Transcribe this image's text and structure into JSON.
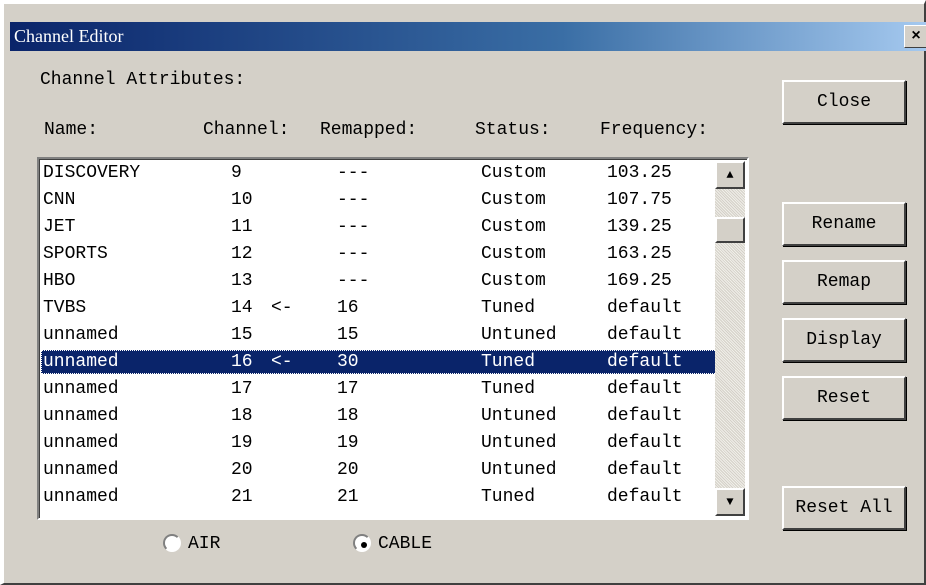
{
  "window": {
    "title": "Channel Editor",
    "close_glyph": "×"
  },
  "labels": {
    "channel_attributes": "Channel Attributes:",
    "col_name": "Name:",
    "col_channel": "Channel:",
    "col_remapped": "Remapped:",
    "col_status": "Status:",
    "col_frequency": "Frequency:"
  },
  "buttons": {
    "close": "Close",
    "rename": "Rename",
    "remap": "Remap",
    "display": "Display",
    "reset": "Reset",
    "reset_all": "Reset All"
  },
  "channels": [
    {
      "name": "DISCOVERY",
      "channel": "9",
      "arrow": "",
      "remapped": "---",
      "status": "Custom",
      "frequency": "103.25"
    },
    {
      "name": "CNN",
      "channel": "10",
      "arrow": "",
      "remapped": "---",
      "status": "Custom",
      "frequency": "107.75"
    },
    {
      "name": "JET",
      "channel": "11",
      "arrow": "",
      "remapped": "---",
      "status": "Custom",
      "frequency": "139.25"
    },
    {
      "name": "SPORTS",
      "channel": "12",
      "arrow": "",
      "remapped": "---",
      "status": "Custom",
      "frequency": "163.25"
    },
    {
      "name": "HBO",
      "channel": "13",
      "arrow": "",
      "remapped": "---",
      "status": "Custom",
      "frequency": "169.25"
    },
    {
      "name": "TVBS",
      "channel": "14",
      "arrow": "<-",
      "remapped": "16",
      "status": "Tuned",
      "frequency": "default"
    },
    {
      "name": "unnamed",
      "channel": "15",
      "arrow": "",
      "remapped": "15",
      "status": "Untuned",
      "frequency": "default"
    },
    {
      "name": "unnamed",
      "channel": "16",
      "arrow": "<-",
      "remapped": "30",
      "status": "Tuned",
      "frequency": "default",
      "selected": true
    },
    {
      "name": "unnamed",
      "channel": "17",
      "arrow": "",
      "remapped": "17",
      "status": "Tuned",
      "frequency": "default"
    },
    {
      "name": "unnamed",
      "channel": "18",
      "arrow": "",
      "remapped": "18",
      "status": "Untuned",
      "frequency": "default"
    },
    {
      "name": "unnamed",
      "channel": "19",
      "arrow": "",
      "remapped": "19",
      "status": "Untuned",
      "frequency": "default"
    },
    {
      "name": "unnamed",
      "channel": "20",
      "arrow": "",
      "remapped": "20",
      "status": "Untuned",
      "frequency": "default"
    },
    {
      "name": "unnamed",
      "channel": "21",
      "arrow": "",
      "remapped": "21",
      "status": "Tuned",
      "frequency": "default"
    }
  ],
  "scroll": {
    "up_glyph": "▲",
    "down_glyph": "▼"
  },
  "source": {
    "air": {
      "label": "AIR",
      "checked": false
    },
    "cable": {
      "label": "CABLE",
      "checked": true
    }
  }
}
